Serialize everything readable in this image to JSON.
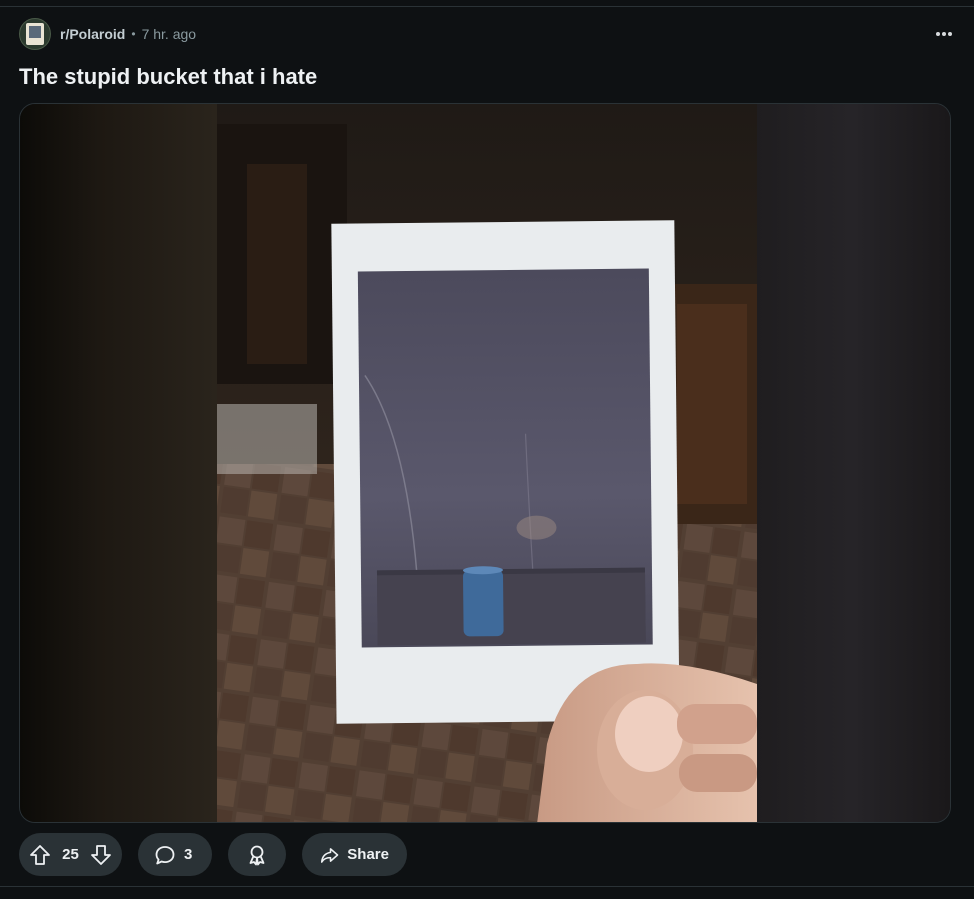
{
  "post": {
    "subreddit": "r/Polaroid",
    "separator": "•",
    "time": "7 hr. ago",
    "title": "The stupid bucket that i hate"
  },
  "actions": {
    "vote_count": "25",
    "comment_count": "3",
    "share_label": "Share"
  },
  "icons": {
    "more": "more-options-icon",
    "upvote": "upvote-arrow-icon",
    "downvote": "downvote-arrow-icon",
    "comment": "comment-bubble-icon",
    "award": "award-ribbon-icon",
    "share": "share-arrow-icon"
  },
  "colors": {
    "background": "#0e1113",
    "pill": "#2a3236",
    "text": "#eef1f3",
    "muted": "#8a9a9f"
  }
}
